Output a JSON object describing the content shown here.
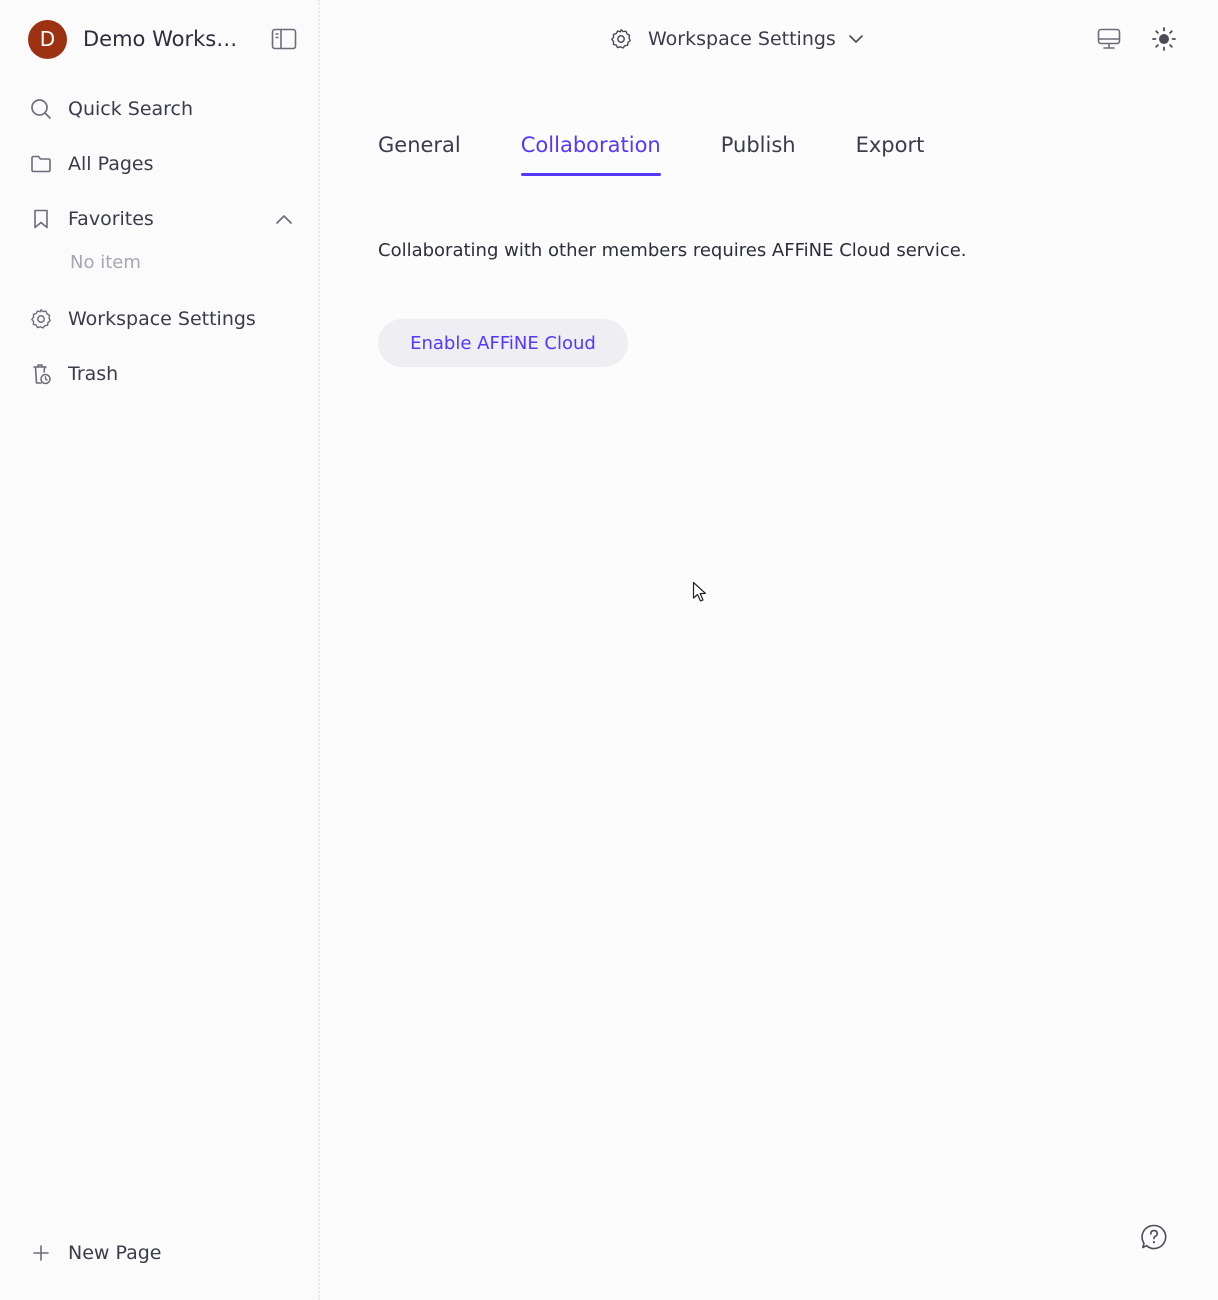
{
  "workspace": {
    "avatar_letter": "D",
    "name": "Demo Workspace",
    "avatar_color": "#9c3212"
  },
  "sidebar": {
    "quick_search": "Quick Search",
    "all_pages": "All Pages",
    "favorites": "Favorites",
    "favorites_empty": "No item",
    "workspace_settings": "Workspace Settings",
    "trash": "Trash",
    "new_page": "New Page"
  },
  "header": {
    "title": "Workspace Settings"
  },
  "tabs": [
    {
      "label": "General",
      "active": false
    },
    {
      "label": "Collaboration",
      "active": true
    },
    {
      "label": "Publish",
      "active": false
    },
    {
      "label": "Export",
      "active": false
    }
  ],
  "collaboration": {
    "description": "Collaborating with other members requires AFFiNE Cloud service.",
    "enable_button": "Enable AFFiNE Cloud"
  },
  "colors": {
    "accent": "#5438ff"
  },
  "icons": [
    "search-icon",
    "folder-icon",
    "bookmark-icon",
    "gear-icon",
    "trash-icon",
    "plus-icon",
    "sidebar-collapse-icon",
    "monitor-icon",
    "sun-icon",
    "help-icon",
    "chevron-up-icon",
    "chevron-down-icon"
  ]
}
